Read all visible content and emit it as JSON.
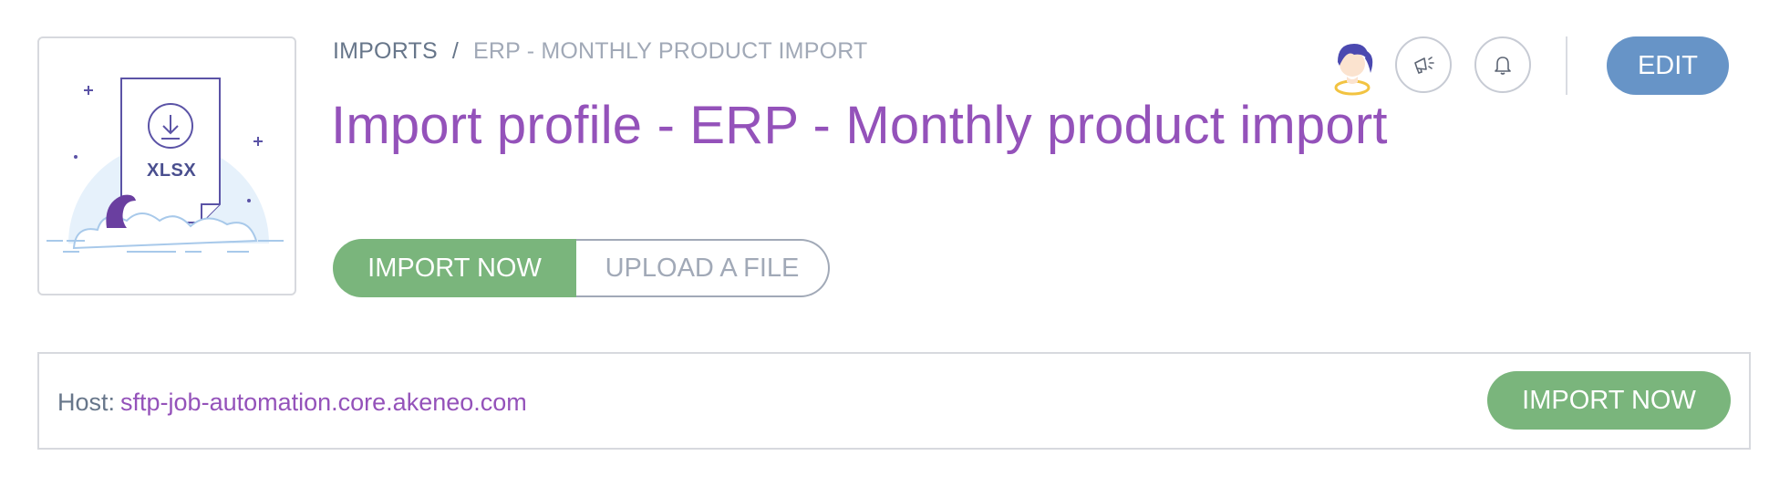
{
  "illustration": {
    "file_type_label": "XLSX",
    "icon": "download-icon"
  },
  "breadcrumb": {
    "parent": "IMPORTS",
    "separator": "/",
    "current": "ERP - MONTHLY PRODUCT IMPORT"
  },
  "header": {
    "title": "Import profile - ERP - Monthly product import",
    "avatar_icon": "user-avatar",
    "announcements_icon": "megaphone-icon",
    "notifications_icon": "bell-icon",
    "edit_label": "EDIT"
  },
  "actions": {
    "import_now_label": "IMPORT NOW",
    "upload_file_label": "UPLOAD A FILE"
  },
  "host_panel": {
    "label": "Host:",
    "value": "sftp-job-automation.core.akeneo.com",
    "import_now_label": "IMPORT NOW"
  },
  "colors": {
    "title_purple": "#9452ba",
    "success_green": "#7ab57c",
    "edit_blue": "#6794c7",
    "text_grey": "#67768a"
  }
}
